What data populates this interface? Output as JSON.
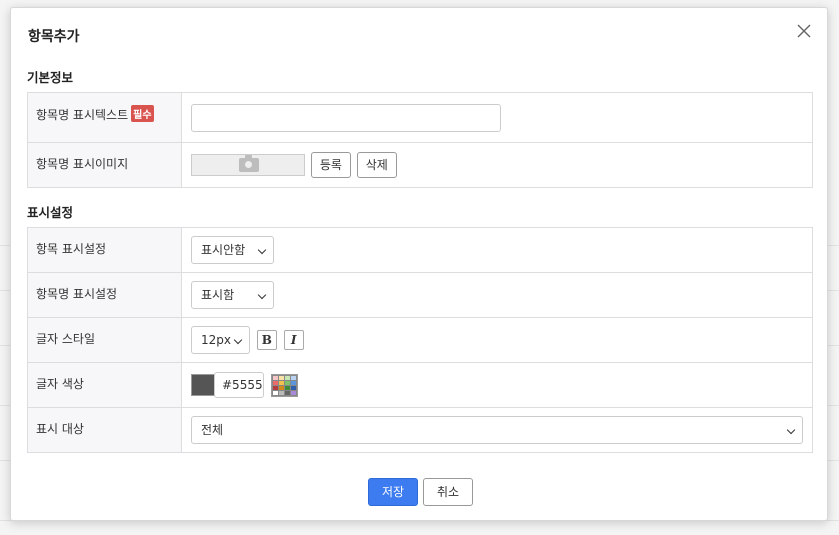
{
  "modal": {
    "title": "항목추가",
    "close_icon": "close-icon"
  },
  "basic_info": {
    "section_title": "기본정보",
    "item_name_text": {
      "label": "항목명 표시텍스트",
      "required_badge": "필수",
      "value": "",
      "placeholder": ""
    },
    "item_name_image": {
      "label": "항목명 표시이미지",
      "image_icon": "camera-icon",
      "register_label": "등록",
      "delete_label": "삭제"
    }
  },
  "display_settings": {
    "section_title": "표시설정",
    "item_display": {
      "label": "항목 표시설정",
      "selected": "표시안함"
    },
    "item_name_display": {
      "label": "항목명 표시설정",
      "selected": "표시함"
    },
    "font_style": {
      "label": "글자 스타일",
      "size_selected": "12px",
      "bold_label": "B",
      "italic_label": "I"
    },
    "font_color": {
      "label": "글자 색상",
      "swatch_color": "#555555",
      "value": "#5555",
      "palette_icon": "color-palette-icon"
    },
    "display_target": {
      "label": "표시 대상",
      "selected": "전체"
    }
  },
  "footer": {
    "save_label": "저장",
    "cancel_label": "취소"
  },
  "colors": {
    "primary": "#3d7cf0",
    "required_badge": "#d9534f",
    "label_bg": "#f7f7f9"
  }
}
